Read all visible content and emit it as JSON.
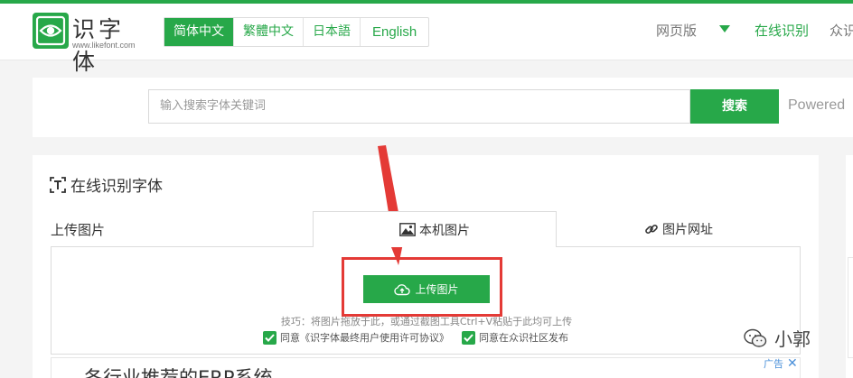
{
  "header": {
    "logo_title": "识字体",
    "logo_sub": "www.likefont.com",
    "languages": [
      "简体中文",
      "繁體中文",
      "日本語",
      "English"
    ],
    "nav_web": "网页版",
    "nav_online": "在线识别",
    "nav_public": "众识"
  },
  "search": {
    "placeholder": "输入搜索字体关键词",
    "button": "搜索",
    "powered": "Powered"
  },
  "main": {
    "section_title": "在线识别字体",
    "upload_label": "上传图片",
    "tab_local": "本机图片",
    "tab_url": "图片网址",
    "upload_button": "上传图片",
    "tip": "技巧：将图片拖放于此，或通过截图工具Ctrl+V粘贴于此均可上传",
    "agree_1": "同意《识字体最终用户使用许可协议》",
    "agree_2": "同意在众识社区发布"
  },
  "below": {
    "title": "各行业推荐的ERP系统"
  },
  "overlay": {
    "watermark": "小郭",
    "ad_label": "广告",
    "ad_close": "✕"
  },
  "colors": {
    "brand": "#27a849",
    "annotation": "#e43a36"
  }
}
